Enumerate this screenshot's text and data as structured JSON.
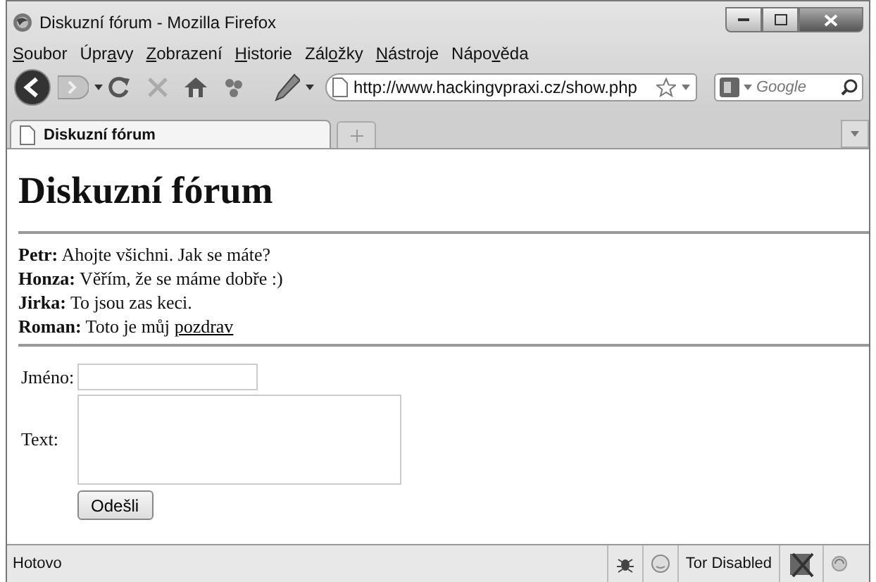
{
  "window": {
    "title": "Diskuzní fórum - Mozilla Firefox"
  },
  "menu": [
    {
      "key": "S",
      "post": "oubor"
    },
    {
      "pre": "Úpr",
      "key": "a",
      "post": "vy"
    },
    {
      "key": "Z",
      "post": "obrazení"
    },
    {
      "key": "H",
      "post": "istorie"
    },
    {
      "pre": "Zál",
      "key": "o",
      "post": "žky"
    },
    {
      "key": "N",
      "post": "ástroje"
    },
    {
      "pre": "Nápo",
      "key": "v",
      "post": "ěda"
    }
  ],
  "toolbar": {
    "url": "http://www.hackingvpraxi.cz/show.php",
    "search_placeholder": "Google"
  },
  "tabs": [
    {
      "label": "Diskuzní fórum",
      "selected": true
    }
  ],
  "page": {
    "heading": "Diskuzní fórum",
    "posts": [
      {
        "author": "Petr:",
        "text": "Ahojte všichni. Jak se máte?"
      },
      {
        "author": "Honza:",
        "text": "Věřím, že se máme dobře :)"
      },
      {
        "author": "Jirka:",
        "text": "To jsou zas keci."
      },
      {
        "author": "Roman:",
        "text": "Toto je můj",
        "link": "pozdrav"
      }
    ],
    "form": {
      "name_label": "Jméno:",
      "text_label": "Text:",
      "submit": "Odešli"
    }
  },
  "status_bar": {
    "text": "Hotovo",
    "tor": "Tor Disabled"
  }
}
